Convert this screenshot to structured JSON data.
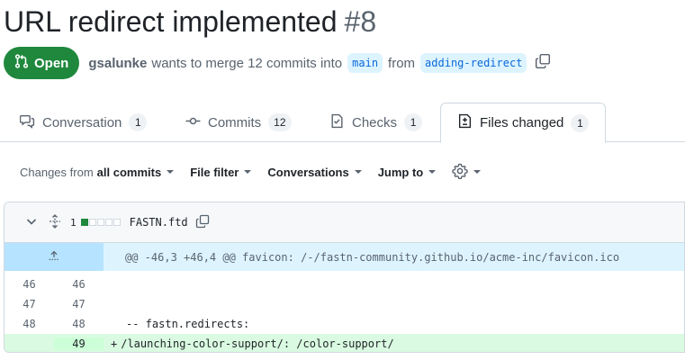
{
  "pr": {
    "title": "URL redirect implemented",
    "number": "#8",
    "state": "Open",
    "author": "gsalunke",
    "merge_text": "wants to merge 12 commits into",
    "base_branch": "main",
    "from_text": "from",
    "head_branch": "adding-redirect"
  },
  "tabs": [
    {
      "label": "Conversation",
      "count": "1",
      "icon": "comment-discussion-icon"
    },
    {
      "label": "Commits",
      "count": "12",
      "icon": "git-commit-icon"
    },
    {
      "label": "Checks",
      "count": "1",
      "icon": "checklist-icon"
    },
    {
      "label": "Files changed",
      "count": "1",
      "icon": "file-diff-icon",
      "active": true
    }
  ],
  "toolbar": {
    "changes_from_prefix": "Changes from",
    "changes_from_value": "all commits",
    "file_filter": "File filter",
    "conversations": "Conversations",
    "jump_to": "Jump to",
    "settings_icon": "gear-icon"
  },
  "file": {
    "changes_count": "1",
    "diffstat": [
      "add",
      "neutral",
      "neutral",
      "neutral",
      "neutral"
    ],
    "name": "FASTN.ftd",
    "hunk_header": "@@ -46,3 +46,4 @@ favicon: /-/fastn-community.github.io/acme-inc/favicon.ico",
    "lines": [
      {
        "old": "46",
        "new": "46",
        "sign": "",
        "text": "",
        "type": "context"
      },
      {
        "old": "47",
        "new": "47",
        "sign": "",
        "text": "",
        "type": "context"
      },
      {
        "old": "48",
        "new": "48",
        "sign": "",
        "text": "-- fastn.redirects:",
        "type": "context"
      },
      {
        "old": "",
        "new": "49",
        "sign": "+",
        "text": "/launching-color-support/: /color-support/",
        "type": "add"
      }
    ]
  },
  "colors": {
    "open_green": "#1f883d",
    "branch_bg": "#ddf4ff",
    "hunk_bg": "#ddf4ff",
    "add_bg": "#dafbe1"
  }
}
